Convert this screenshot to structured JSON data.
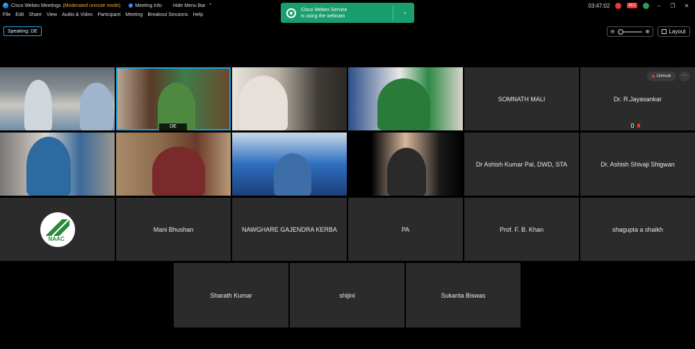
{
  "app": {
    "title": "Cisco Webex Meetings",
    "mode": "(Moderated unmute mode)",
    "meeting_info": "Meeting Info",
    "hide_menu": "Hide Menu Bar",
    "clock": "03:47:02",
    "rec_label": "REC"
  },
  "menu": [
    "File",
    "Edit",
    "Share",
    "View",
    "Audio & Video",
    "Participant",
    "Meeting",
    "Breakout Sessions",
    "Help"
  ],
  "toast": {
    "line1": "Cisco Webex Service",
    "line2": "is using the webcam"
  },
  "speaking": "Speaking: DE",
  "layout_label": "Layout",
  "tiles": {
    "de_label": "DE",
    "somnath": "SOMNATH MALI",
    "jayasankar": "Dr. R.Jayasankar",
    "unmute": "Unmute",
    "more": "···",
    "ashish_pal": "Dr Ashish Kumar Pal, DWD, STA",
    "ashish_shigwan": "Dr. Ashish Shivaji Shigwan",
    "naaac_text": "NAAC",
    "mani": "Mani Bhushan",
    "nawghare": "NAWGHARE GAJENDRA KERBA",
    "pa": "PA",
    "khan": "Prof. F. B. Khan",
    "shagupta": "shagupta a shaikh",
    "sharath": "Sharath Kumar",
    "shijini": "shijini",
    "sukanta": "Sukanta Biswas"
  }
}
